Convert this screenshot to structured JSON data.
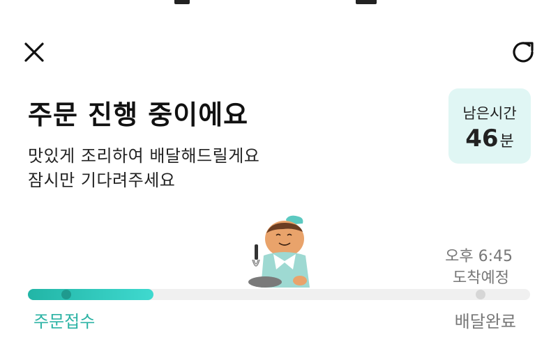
{
  "header": {
    "close_icon": "close-icon",
    "refresh_icon": "refresh-icon"
  },
  "main": {
    "title": "주문 진행 중이에요",
    "subtitle_line1": "맛있게 조리하여 배달해드릴게요",
    "subtitle_line2": "잠시만 기다려주세요"
  },
  "remaining": {
    "label": "남은시간",
    "value": "46",
    "unit": "분"
  },
  "eta": {
    "time": "오후 6:45",
    "label": "도착예정"
  },
  "progress": {
    "fraction": 0.25,
    "start_label": "주문접수",
    "end_label": "배달완료"
  },
  "illustration": "chef-cooking-illustration",
  "colors": {
    "accent": "#2bb3a4",
    "time_box_bg": "#e0f6f4",
    "muted_text": "#777777"
  }
}
